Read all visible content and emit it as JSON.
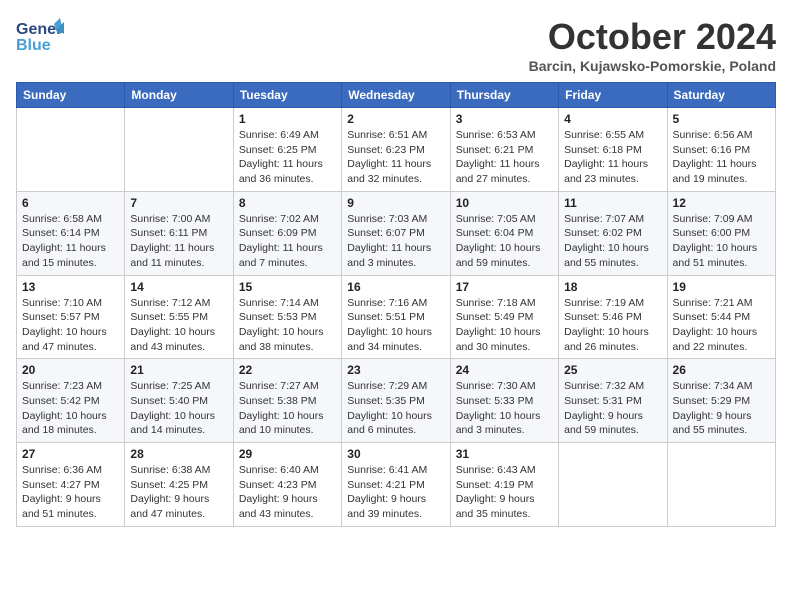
{
  "header": {
    "logo_line1": "General",
    "logo_line2": "Blue",
    "month": "October 2024",
    "location": "Barcin, Kujawsko-Pomorskie, Poland"
  },
  "weekdays": [
    "Sunday",
    "Monday",
    "Tuesday",
    "Wednesday",
    "Thursday",
    "Friday",
    "Saturday"
  ],
  "weeks": [
    [
      {
        "day": "",
        "info": ""
      },
      {
        "day": "",
        "info": ""
      },
      {
        "day": "1",
        "info": "Sunrise: 6:49 AM\nSunset: 6:25 PM\nDaylight: 11 hours and 36 minutes."
      },
      {
        "day": "2",
        "info": "Sunrise: 6:51 AM\nSunset: 6:23 PM\nDaylight: 11 hours and 32 minutes."
      },
      {
        "day": "3",
        "info": "Sunrise: 6:53 AM\nSunset: 6:21 PM\nDaylight: 11 hours and 27 minutes."
      },
      {
        "day": "4",
        "info": "Sunrise: 6:55 AM\nSunset: 6:18 PM\nDaylight: 11 hours and 23 minutes."
      },
      {
        "day": "5",
        "info": "Sunrise: 6:56 AM\nSunset: 6:16 PM\nDaylight: 11 hours and 19 minutes."
      }
    ],
    [
      {
        "day": "6",
        "info": "Sunrise: 6:58 AM\nSunset: 6:14 PM\nDaylight: 11 hours and 15 minutes."
      },
      {
        "day": "7",
        "info": "Sunrise: 7:00 AM\nSunset: 6:11 PM\nDaylight: 11 hours and 11 minutes."
      },
      {
        "day": "8",
        "info": "Sunrise: 7:02 AM\nSunset: 6:09 PM\nDaylight: 11 hours and 7 minutes."
      },
      {
        "day": "9",
        "info": "Sunrise: 7:03 AM\nSunset: 6:07 PM\nDaylight: 11 hours and 3 minutes."
      },
      {
        "day": "10",
        "info": "Sunrise: 7:05 AM\nSunset: 6:04 PM\nDaylight: 10 hours and 59 minutes."
      },
      {
        "day": "11",
        "info": "Sunrise: 7:07 AM\nSunset: 6:02 PM\nDaylight: 10 hours and 55 minutes."
      },
      {
        "day": "12",
        "info": "Sunrise: 7:09 AM\nSunset: 6:00 PM\nDaylight: 10 hours and 51 minutes."
      }
    ],
    [
      {
        "day": "13",
        "info": "Sunrise: 7:10 AM\nSunset: 5:57 PM\nDaylight: 10 hours and 47 minutes."
      },
      {
        "day": "14",
        "info": "Sunrise: 7:12 AM\nSunset: 5:55 PM\nDaylight: 10 hours and 43 minutes."
      },
      {
        "day": "15",
        "info": "Sunrise: 7:14 AM\nSunset: 5:53 PM\nDaylight: 10 hours and 38 minutes."
      },
      {
        "day": "16",
        "info": "Sunrise: 7:16 AM\nSunset: 5:51 PM\nDaylight: 10 hours and 34 minutes."
      },
      {
        "day": "17",
        "info": "Sunrise: 7:18 AM\nSunset: 5:49 PM\nDaylight: 10 hours and 30 minutes."
      },
      {
        "day": "18",
        "info": "Sunrise: 7:19 AM\nSunset: 5:46 PM\nDaylight: 10 hours and 26 minutes."
      },
      {
        "day": "19",
        "info": "Sunrise: 7:21 AM\nSunset: 5:44 PM\nDaylight: 10 hours and 22 minutes."
      }
    ],
    [
      {
        "day": "20",
        "info": "Sunrise: 7:23 AM\nSunset: 5:42 PM\nDaylight: 10 hours and 18 minutes."
      },
      {
        "day": "21",
        "info": "Sunrise: 7:25 AM\nSunset: 5:40 PM\nDaylight: 10 hours and 14 minutes."
      },
      {
        "day": "22",
        "info": "Sunrise: 7:27 AM\nSunset: 5:38 PM\nDaylight: 10 hours and 10 minutes."
      },
      {
        "day": "23",
        "info": "Sunrise: 7:29 AM\nSunset: 5:35 PM\nDaylight: 10 hours and 6 minutes."
      },
      {
        "day": "24",
        "info": "Sunrise: 7:30 AM\nSunset: 5:33 PM\nDaylight: 10 hours and 3 minutes."
      },
      {
        "day": "25",
        "info": "Sunrise: 7:32 AM\nSunset: 5:31 PM\nDaylight: 9 hours and 59 minutes."
      },
      {
        "day": "26",
        "info": "Sunrise: 7:34 AM\nSunset: 5:29 PM\nDaylight: 9 hours and 55 minutes."
      }
    ],
    [
      {
        "day": "27",
        "info": "Sunrise: 6:36 AM\nSunset: 4:27 PM\nDaylight: 9 hours and 51 minutes."
      },
      {
        "day": "28",
        "info": "Sunrise: 6:38 AM\nSunset: 4:25 PM\nDaylight: 9 hours and 47 minutes."
      },
      {
        "day": "29",
        "info": "Sunrise: 6:40 AM\nSunset: 4:23 PM\nDaylight: 9 hours and 43 minutes."
      },
      {
        "day": "30",
        "info": "Sunrise: 6:41 AM\nSunset: 4:21 PM\nDaylight: 9 hours and 39 minutes."
      },
      {
        "day": "31",
        "info": "Sunrise: 6:43 AM\nSunset: 4:19 PM\nDaylight: 9 hours and 35 minutes."
      },
      {
        "day": "",
        "info": ""
      },
      {
        "day": "",
        "info": ""
      }
    ]
  ]
}
